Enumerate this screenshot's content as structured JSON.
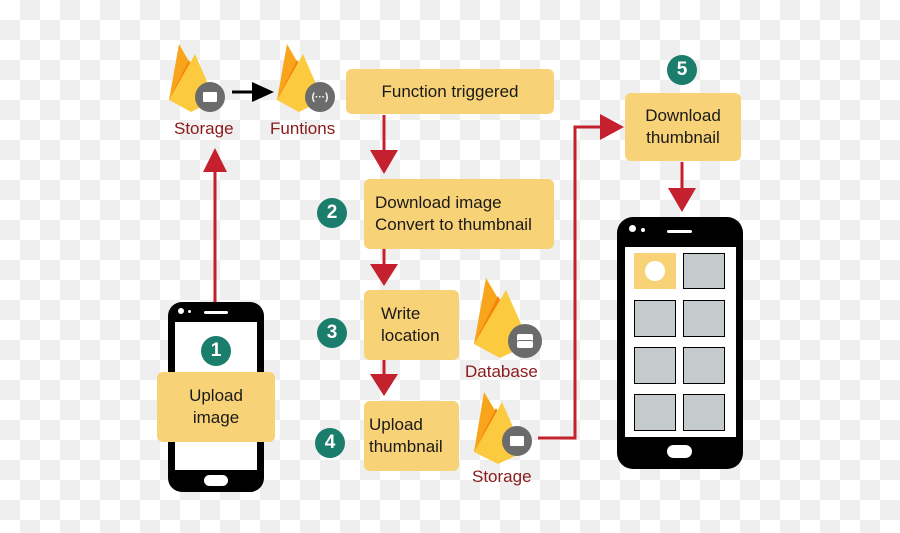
{
  "nodes": {
    "storage_top": "Storage",
    "functions": "Funtions",
    "database": "Database",
    "storage_bottom": "Storage"
  },
  "steps": {
    "function_triggered": "Function triggered",
    "step1": {
      "number": "1",
      "label": "Upload\nimage"
    },
    "step2": {
      "number": "2",
      "label": "Download image\nConvert to thumbnail"
    },
    "step3": {
      "number": "3",
      "label": "Write\nlocation"
    },
    "step4": {
      "number": "4",
      "label": "Upload\nthumbnail"
    },
    "step5": {
      "number": "5",
      "label": "Download\nthumbnail"
    }
  },
  "icons": {
    "storage": "folder-image-icon",
    "functions": "braces-icon",
    "database": "server-icon"
  },
  "colors": {
    "box": "#f8d276",
    "badge": "#1b7d6b",
    "arrow": "#c4202e",
    "label": "#8b1a1a",
    "thumbnail": "#c5cbcc"
  }
}
